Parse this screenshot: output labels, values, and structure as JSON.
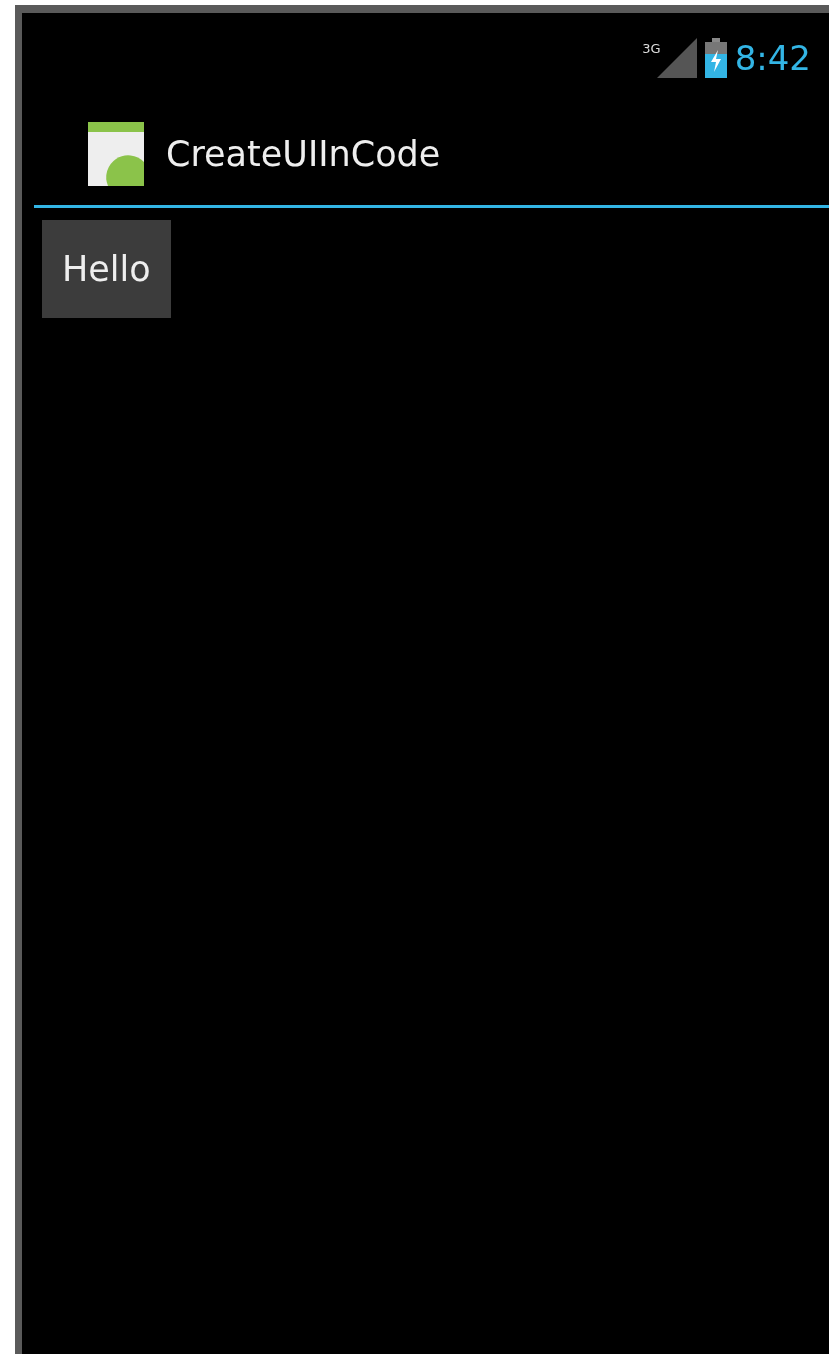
{
  "status_bar": {
    "network": "3G",
    "time": "8:42"
  },
  "action_bar": {
    "title": "CreateUIInCode"
  },
  "content": {
    "button": "Hello"
  }
}
